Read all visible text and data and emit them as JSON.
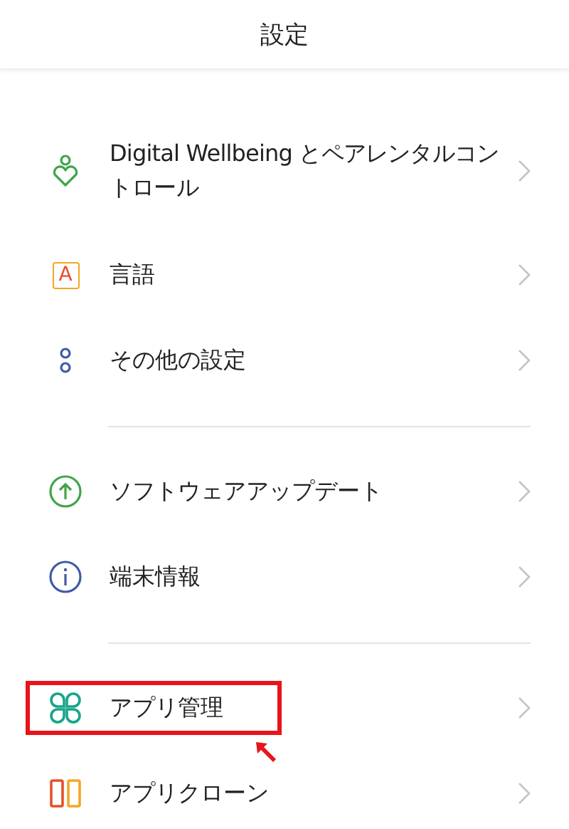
{
  "header": {
    "title": "設定"
  },
  "sections": [
    {
      "items": [
        {
          "kind": "wellbeing",
          "label": "Digital Wellbeing とペアレンタルコントロール",
          "highlighted": false
        },
        {
          "kind": "letter",
          "icon_text": "A",
          "label": "言語",
          "highlighted": false
        },
        {
          "kind": "dots",
          "label": "その他の設定",
          "highlighted": false
        }
      ]
    },
    {
      "items": [
        {
          "kind": "update",
          "label": "ソフトウェアアップデート",
          "highlighted": false
        },
        {
          "kind": "info",
          "label": "端末情報",
          "highlighted": false
        }
      ]
    },
    {
      "items": [
        {
          "kind": "apps",
          "label": "アプリ管理",
          "highlighted": true
        },
        {
          "kind": "clone",
          "label": "アプリクローン",
          "highlighted": false
        }
      ]
    }
  ]
}
